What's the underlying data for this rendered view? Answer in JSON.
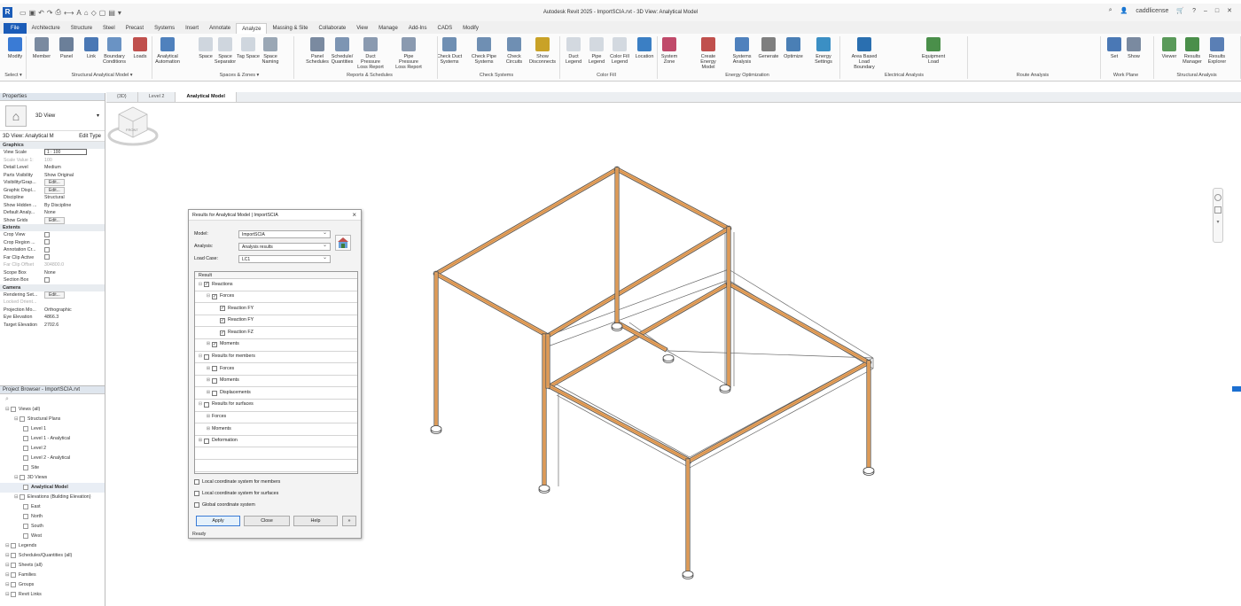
{
  "window": {
    "title": "Autodesk Revit 2025 - ImportSCIA.rvt - 3D View: Analytical Model",
    "user": "caddlicense"
  },
  "menu_tabs": [
    "File",
    "Architecture",
    "Structure",
    "Steel",
    "Precast",
    "Systems",
    "Insert",
    "Annotate",
    "Analyze",
    "Massing & Site",
    "Collaborate",
    "View",
    "Manage",
    "Add-Ins",
    "CADS",
    "Modify"
  ],
  "active_tab": "Analyze",
  "ribbon": {
    "buttons": [
      {
        "label": "Modify",
        "color": "#3a7bd5"
      },
      {
        "label": "Member",
        "color": "#7a8aa0"
      },
      {
        "label": "Panel",
        "color": "#6b7f99"
      },
      {
        "label": "Link",
        "color": "#4a78b5"
      },
      {
        "label": "Boundary Conditions",
        "color": "#6a93c4"
      },
      {
        "label": "Loads",
        "color": "#c0504d"
      },
      {
        "label": "Analytical Automation",
        "color": "#4f81bd"
      },
      {
        "label": "Space",
        "color": "#cfd6de"
      },
      {
        "label": "Space Separator",
        "color": "#cfd6de"
      },
      {
        "label": "Tag Space",
        "color": "#cfd6de"
      },
      {
        "label": "Space Naming",
        "color": "#9aa7b5"
      },
      {
        "label": "Panel Schedules",
        "color": "#7a8aa0"
      },
      {
        "label": "Schedule/ Quantities",
        "color": "#7d95b3"
      },
      {
        "label": "Duct Pressure Loss Report",
        "color": "#8a9ab0"
      },
      {
        "label": "Pipe Pressure Loss Report",
        "color": "#8a9ab0"
      },
      {
        "label": "Check Duct Systems",
        "color": "#6f8fb3"
      },
      {
        "label": "Check Pipe Systems",
        "color": "#6f8fb3"
      },
      {
        "label": "Check Circuits",
        "color": "#6f8fb3"
      },
      {
        "label": "Show Disconnects",
        "color": "#c9a227"
      },
      {
        "label": "Duct Legend",
        "color": "#d3d9e0"
      },
      {
        "label": "Pipe Legend",
        "color": "#d3d9e0"
      },
      {
        "label": "Color Fill Legend",
        "color": "#d3d9e0"
      },
      {
        "label": "Location",
        "color": "#3b7fc4"
      },
      {
        "label": "System Zone",
        "color": "#c04a6a"
      },
      {
        "label": "Create Energy Model",
        "color": "#c0504d"
      },
      {
        "label": "Systems Analysis",
        "color": "#4f81bd"
      },
      {
        "label": "Generate",
        "color": "#7f7f7f"
      },
      {
        "label": "Optimize",
        "color": "#4a7fb5"
      },
      {
        "label": "Energy Settings",
        "color": "#3b8fc4"
      },
      {
        "label": "Area Based Load Boundary",
        "color": "#2a6fb0"
      },
      {
        "label": "Equipment Load",
        "color": "#4a8f4a"
      },
      {
        "label": "Set",
        "color": "#4a78b5"
      },
      {
        "label": "Show",
        "color": "#7a8aa0"
      },
      {
        "label": "Viewer",
        "color": "#5a9a5a"
      },
      {
        "label": "Results Manager",
        "color": "#4a8f4a"
      },
      {
        "label": "Results Explorer",
        "color": "#5a7fb5"
      }
    ],
    "groups": [
      "Select ▾",
      "Structural Analytical Model ▾",
      "Spaces & Zones ▾",
      "Reports & Schedules",
      "Check Systems",
      "Color Fill",
      "Energy Optimization",
      "Electrical Analysis",
      "Route Analysis",
      "Work Plane",
      "Structural Analysis"
    ]
  },
  "properties": {
    "header": "Properties",
    "type_label": "3D View",
    "instance_label": "3D View: Analytical M",
    "edit_type": "Edit Type",
    "sections": [
      {
        "name": "Graphics",
        "rows": [
          {
            "k": "View Scale",
            "v": "1 : 100",
            "box": true
          },
          {
            "k": "Scale Value 1:",
            "v": "100",
            "dim": true
          },
          {
            "k": "Detail Level",
            "v": "Medium"
          },
          {
            "k": "Parts Visibility",
            "v": "Show Original"
          },
          {
            "k": "Visibility/Grap...",
            "v": "Edit...",
            "btn": true
          },
          {
            "k": "Graphic Displ...",
            "v": "Edit...",
            "btn": true
          },
          {
            "k": "Discipline",
            "v": "Structural"
          },
          {
            "k": "Show Hidden ...",
            "v": "By Discipline"
          },
          {
            "k": "Default Analy...",
            "v": "None"
          },
          {
            "k": "Show Grids",
            "v": "Edit...",
            "btn": true
          }
        ]
      },
      {
        "name": "Extents",
        "rows": [
          {
            "k": "Crop View",
            "v": "",
            "chk": true
          },
          {
            "k": "Crop Region ...",
            "v": "",
            "chk": true
          },
          {
            "k": "Annotation Cr...",
            "v": "",
            "chk": true
          },
          {
            "k": "Far Clip Active",
            "v": "",
            "chk": true
          },
          {
            "k": "Far Clip Offset",
            "v": "304800.0",
            "dim": true
          },
          {
            "k": "Scope Box",
            "v": "None"
          },
          {
            "k": "Section Box",
            "v": "",
            "chk": true
          }
        ]
      },
      {
        "name": "Camera",
        "rows": [
          {
            "k": "Rendering Set...",
            "v": "Edit...",
            "btn": true
          },
          {
            "k": "Locked Orient...",
            "v": "",
            "dim": true
          },
          {
            "k": "Projection Mo...",
            "v": "Orthographic"
          },
          {
            "k": "Eye Elevation",
            "v": "4866.3"
          },
          {
            "k": "Target Elevation",
            "v": "2702.6"
          }
        ]
      }
    ]
  },
  "project_browser": {
    "header": "Project Browser - ImportSCIA.rvt",
    "items": [
      {
        "label": "Views (all)",
        "indent": 0,
        "sel": false
      },
      {
        "label": "Structural Plans",
        "indent": 1,
        "sel": false
      },
      {
        "label": "Level 1",
        "indent": 2,
        "sel": false
      },
      {
        "label": "Level 1 - Analytical",
        "indent": 2,
        "sel": false
      },
      {
        "label": "Level 2",
        "indent": 2,
        "sel": false
      },
      {
        "label": "Level 2 - Analytical",
        "indent": 2,
        "sel": false
      },
      {
        "label": "Site",
        "indent": 2,
        "sel": false
      },
      {
        "label": "3D Views",
        "indent": 1,
        "sel": false
      },
      {
        "label": "Analytical Model",
        "indent": 2,
        "sel": true
      },
      {
        "label": "Elevations (Building Elevation)",
        "indent": 1,
        "sel": false
      },
      {
        "label": "East",
        "indent": 2,
        "sel": false
      },
      {
        "label": "North",
        "indent": 2,
        "sel": false
      },
      {
        "label": "South",
        "indent": 2,
        "sel": false
      },
      {
        "label": "West",
        "indent": 2,
        "sel": false
      },
      {
        "label": "Legends",
        "indent": 0,
        "sel": false
      },
      {
        "label": "Schedules/Quantities (all)",
        "indent": 0,
        "sel": false
      },
      {
        "label": "Sheets (all)",
        "indent": 0,
        "sel": false
      },
      {
        "label": "Families",
        "indent": 0,
        "sel": false
      },
      {
        "label": "Groups",
        "indent": 0,
        "sel": false
      },
      {
        "label": "Revit Links",
        "indent": 0,
        "sel": false
      }
    ]
  },
  "view_tabs": [
    {
      "label": "{3D}",
      "active": false
    },
    {
      "label": "Level 2",
      "active": false
    },
    {
      "label": "Analytical Model",
      "active": true
    }
  ],
  "dialog": {
    "title": "Results for Analytical Model | ImportSCIA",
    "fields": [
      {
        "label": "Model:",
        "value": "ImportSCIA"
      },
      {
        "label": "Analysis:",
        "value": "Analysis results"
      },
      {
        "label": "Load Case:",
        "value": "LC1"
      }
    ],
    "tree_header": "Result",
    "tree": [
      {
        "label": "Reactions",
        "indent": 0,
        "checked": true,
        "exp": "⊟"
      },
      {
        "label": "Forces",
        "indent": 1,
        "checked": true,
        "exp": "⊟"
      },
      {
        "label": "Reaction FY",
        "indent": 2,
        "checked": true,
        "exp": ""
      },
      {
        "label": "Reaction FY",
        "indent": 2,
        "checked": true,
        "exp": ""
      },
      {
        "label": "Reaction FZ",
        "indent": 2,
        "checked": true,
        "exp": ""
      },
      {
        "label": "Moments",
        "indent": 1,
        "checked": true,
        "exp": "⊞"
      },
      {
        "label": "Results for members",
        "indent": 0,
        "checked": false,
        "exp": "⊟"
      },
      {
        "label": "Forces",
        "indent": 1,
        "checked": false,
        "exp": "⊞"
      },
      {
        "label": "Moments",
        "indent": 1,
        "checked": false,
        "exp": "⊞"
      },
      {
        "label": "Displacements",
        "indent": 1,
        "checked": false,
        "exp": "⊞"
      },
      {
        "label": "Results for surfaces",
        "indent": 0,
        "checked": false,
        "exp": "⊟"
      },
      {
        "label": "Forces",
        "indent": 1,
        "checked": null,
        "exp": "⊞"
      },
      {
        "label": "Moments",
        "indent": 1,
        "checked": null,
        "exp": "⊞"
      },
      {
        "label": "Deformation",
        "indent": 0,
        "checked": false,
        "exp": "⊞"
      },
      {
        "label": "",
        "indent": 0,
        "checked": null,
        "exp": ""
      },
      {
        "label": "",
        "indent": 0,
        "checked": null,
        "exp": ""
      }
    ],
    "options": [
      "Local coordinate system for members",
      "Local coordinate system for surfaces",
      "Global coordinate system"
    ],
    "buttons": {
      "apply": "Apply",
      "close": "Close",
      "help": "Help",
      "more": "»"
    },
    "status": "Ready"
  },
  "viewcube": {
    "face": "FRONT"
  }
}
